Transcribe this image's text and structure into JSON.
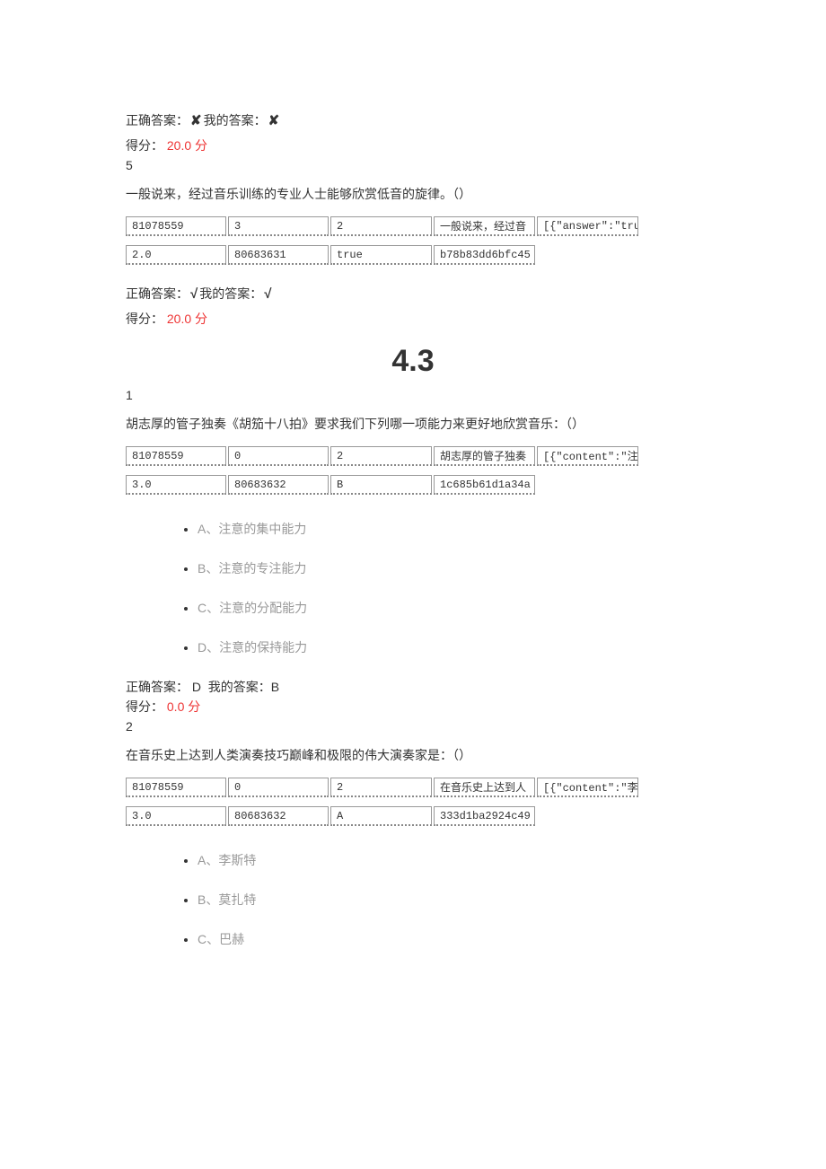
{
  "labels": {
    "correct_answer": "正确答案：",
    "my_answer": "我的答案：",
    "score_label": "得分：",
    "score_unit": "分"
  },
  "marks": {
    "cross": "✘",
    "check": "√"
  },
  "q4": {
    "score": "20.0"
  },
  "q5": {
    "number": "5",
    "text": "一般说来，经过音乐训练的专业人士能够欣赏低音的旋律。（）",
    "row1": [
      "81078559",
      "3",
      "2",
      "一般说来，经过音",
      "[{\"answer\":\"tru"
    ],
    "row2": [
      "2.0",
      "80683631",
      "true",
      "b78b83dd6bfc45"
    ],
    "score": "20.0"
  },
  "section": "4.3",
  "q6": {
    "number": "1",
    "text": "胡志厚的管子独奏《胡笳十八拍》要求我们下列哪一项能力来更好地欣赏音乐：（）",
    "row1": [
      "81078559",
      "0",
      "2",
      "胡志厚的管子独奏",
      "[{\"content\":\"注"
    ],
    "row2": [
      "3.0",
      "80683632",
      "B",
      "1c685b61d1a34a"
    ],
    "options": [
      "A、注意的集中能力",
      "B、注意的专注能力",
      "C、注意的分配能力",
      "D、注意的保持能力"
    ],
    "correct": "D",
    "mine": "B",
    "score": "0.0"
  },
  "q7": {
    "number": "2",
    "text": "在音乐史上达到人类演奏技巧巅峰和极限的伟大演奏家是：（）",
    "row1": [
      "81078559",
      "0",
      "2",
      "在音乐史上达到人",
      "[{\"content\":\"李"
    ],
    "row2": [
      "3.0",
      "80683632",
      "A",
      "333d1ba2924c49"
    ],
    "options": [
      "A、李斯特",
      "B、莫扎特",
      "C、巴赫"
    ]
  }
}
